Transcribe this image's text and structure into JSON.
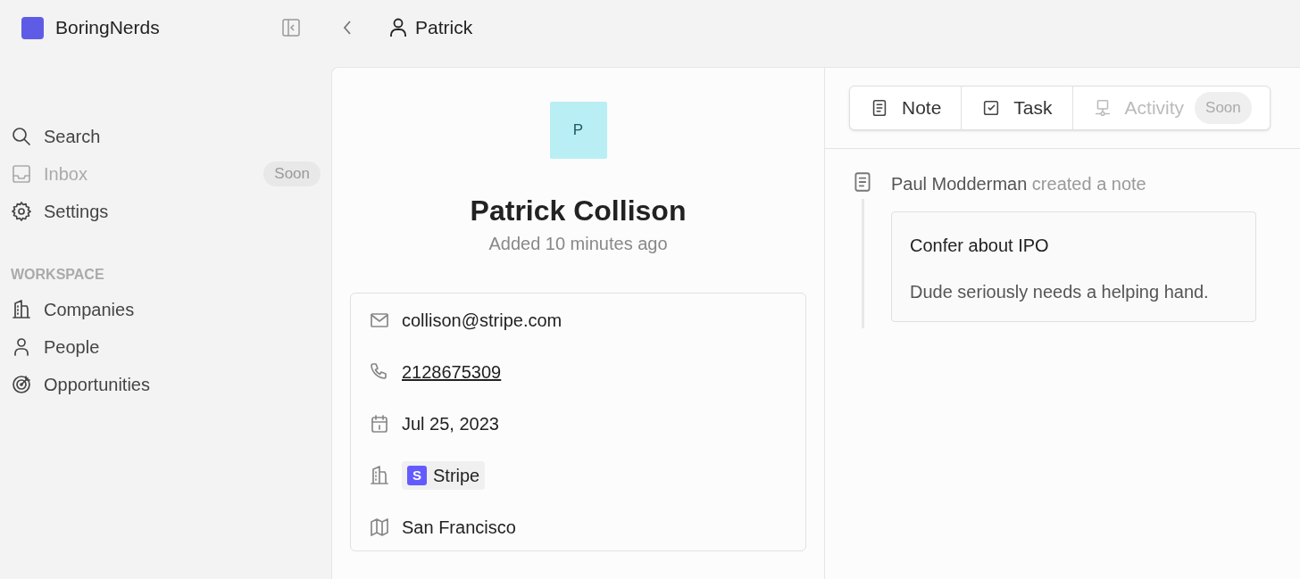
{
  "app": {
    "name": "BoringNerds"
  },
  "breadcrumb": {
    "title": "Patrick"
  },
  "sidebar": {
    "items": [
      {
        "label": "Search",
        "disabled": false
      },
      {
        "label": "Inbox",
        "disabled": true,
        "badge": "Soon"
      },
      {
        "label": "Settings",
        "disabled": false
      }
    ],
    "section": "WORKSPACE",
    "workspace_items": [
      {
        "label": "Companies"
      },
      {
        "label": "People"
      },
      {
        "label": "Opportunities"
      }
    ]
  },
  "person": {
    "avatar_letter": "P",
    "name": "Patrick Collison",
    "added": "Added 10 minutes ago",
    "fields": [
      {
        "kind": "email",
        "value": "collison@stripe.com"
      },
      {
        "kind": "phone",
        "value": "2128675309"
      },
      {
        "kind": "date",
        "value": "Jul 25, 2023"
      },
      {
        "kind": "company",
        "value": "Stripe",
        "logo_letter": "S"
      },
      {
        "kind": "location",
        "value": "San Francisco"
      }
    ]
  },
  "tabs": [
    {
      "kind": "note",
      "label": "Note",
      "disabled": false
    },
    {
      "kind": "task",
      "label": "Task",
      "disabled": false
    },
    {
      "kind": "activity",
      "label": "Activity",
      "disabled": true,
      "badge": "Soon"
    }
  ],
  "timeline": [
    {
      "author": "Paul Modderman",
      "action": "created a note",
      "note_title": "Confer about IPO",
      "note_body": "Dude seriously needs a helping hand."
    }
  ]
}
